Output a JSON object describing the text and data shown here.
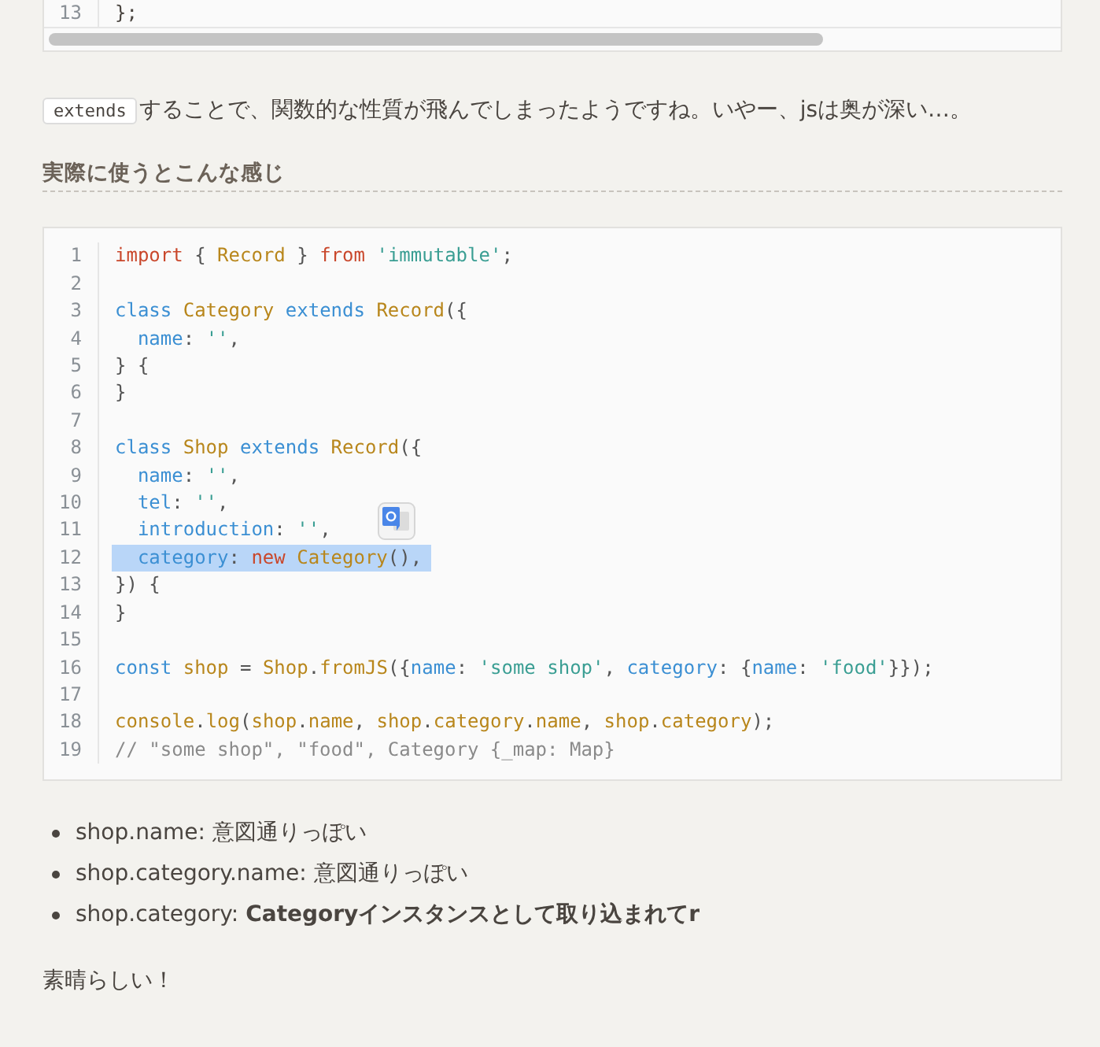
{
  "top_code": {
    "lines": [
      {
        "number": "13",
        "text": "};"
      }
    ]
  },
  "paragraph": {
    "code": "extends",
    "text": "することで、関数的な性質が飛んでしまったようですね。いやー、jsは奥が深い…。"
  },
  "heading": "実際に使うとこんな感じ",
  "code": {
    "lines": [
      {
        "number": "1",
        "selected": false,
        "tokens": [
          {
            "kind": "keyword",
            "text": "import"
          },
          {
            "kind": "plain",
            "text": " { "
          },
          {
            "kind": "name",
            "text": "Record"
          },
          {
            "kind": "plain",
            "text": " } "
          },
          {
            "kind": "keyword",
            "text": "from "
          },
          {
            "kind": "string",
            "text": "'immutable'"
          },
          {
            "kind": "plain",
            "text": ";"
          }
        ]
      },
      {
        "number": "2",
        "selected": false
      },
      {
        "number": "3",
        "selected": false,
        "tokens": [
          {
            "kind": "decl",
            "text": "class "
          },
          {
            "kind": "name",
            "text": "Category "
          },
          {
            "kind": "decl",
            "text": "extends "
          },
          {
            "kind": "name",
            "text": "Record"
          },
          {
            "kind": "plain",
            "text": "({"
          }
        ]
      },
      {
        "number": "4",
        "selected": false,
        "tokens": [
          {
            "kind": "decl",
            "text": "  name"
          },
          {
            "kind": "plain",
            "text": ": "
          },
          {
            "kind": "string",
            "text": "''"
          },
          {
            "kind": "plain",
            "text": ","
          }
        ]
      },
      {
        "number": "5",
        "selected": false,
        "tokens": [
          {
            "kind": "plain",
            "text": "} {"
          }
        ]
      },
      {
        "number": "6",
        "selected": false,
        "tokens": [
          {
            "kind": "plain",
            "text": "}"
          }
        ]
      },
      {
        "number": "7",
        "selected": false
      },
      {
        "number": "8",
        "selected": false,
        "tokens": [
          {
            "kind": "decl",
            "text": "class "
          },
          {
            "kind": "name",
            "text": "Shop "
          },
          {
            "kind": "decl",
            "text": "extends "
          },
          {
            "kind": "name",
            "text": "Record"
          },
          {
            "kind": "plain",
            "text": "({"
          }
        ]
      },
      {
        "number": "9",
        "selected": false,
        "tokens": [
          {
            "kind": "decl",
            "text": "  name"
          },
          {
            "kind": "plain",
            "text": ": "
          },
          {
            "kind": "string",
            "text": "''"
          },
          {
            "kind": "plain",
            "text": ","
          }
        ]
      },
      {
        "number": "10",
        "selected": false,
        "tokens": [
          {
            "kind": "decl",
            "text": "  tel"
          },
          {
            "kind": "plain",
            "text": ": "
          },
          {
            "kind": "string",
            "text": "''"
          },
          {
            "kind": "plain",
            "text": ","
          }
        ]
      },
      {
        "number": "11",
        "selected": false,
        "tokens": [
          {
            "kind": "decl",
            "text": "  introduction"
          },
          {
            "kind": "plain",
            "text": ": "
          },
          {
            "kind": "string",
            "text": "''"
          },
          {
            "kind": "plain",
            "text": ","
          }
        ]
      },
      {
        "number": "12",
        "selected": true,
        "tokens": [
          {
            "kind": "decl",
            "text": "  category"
          },
          {
            "kind": "plain",
            "text": ": "
          },
          {
            "kind": "keyword",
            "text": "new "
          },
          {
            "kind": "name",
            "text": "Category"
          },
          {
            "kind": "plain",
            "text": "(),"
          }
        ]
      },
      {
        "number": "13",
        "selected": false,
        "tokens": [
          {
            "kind": "plain",
            "text": "}) {"
          }
        ]
      },
      {
        "number": "14",
        "selected": false,
        "tokens": [
          {
            "kind": "plain",
            "text": "}"
          }
        ]
      },
      {
        "number": "15",
        "selected": false
      },
      {
        "number": "16",
        "selected": false,
        "tokens": [
          {
            "kind": "decl",
            "text": "const "
          },
          {
            "kind": "name",
            "text": "shop"
          },
          {
            "kind": "plain",
            "text": " = "
          },
          {
            "kind": "name",
            "text": "Shop"
          },
          {
            "kind": "plain",
            "text": "."
          },
          {
            "kind": "name",
            "text": "fromJS"
          },
          {
            "kind": "plain",
            "text": "({"
          },
          {
            "kind": "decl",
            "text": "name"
          },
          {
            "kind": "plain",
            "text": ": "
          },
          {
            "kind": "string",
            "text": "'some shop'"
          },
          {
            "kind": "plain",
            "text": ", "
          },
          {
            "kind": "decl",
            "text": "category"
          },
          {
            "kind": "plain",
            "text": ": {"
          },
          {
            "kind": "decl",
            "text": "name"
          },
          {
            "kind": "plain",
            "text": ": "
          },
          {
            "kind": "string",
            "text": "'food'"
          },
          {
            "kind": "plain",
            "text": "}});"
          }
        ]
      },
      {
        "number": "17",
        "selected": false
      },
      {
        "number": "18",
        "selected": false,
        "tokens": [
          {
            "kind": "name",
            "text": "console"
          },
          {
            "kind": "plain",
            "text": "."
          },
          {
            "kind": "name",
            "text": "log"
          },
          {
            "kind": "plain",
            "text": "("
          },
          {
            "kind": "name",
            "text": "shop"
          },
          {
            "kind": "plain",
            "text": "."
          },
          {
            "kind": "name",
            "text": "name"
          },
          {
            "kind": "plain",
            "text": ", "
          },
          {
            "kind": "name",
            "text": "shop"
          },
          {
            "kind": "plain",
            "text": "."
          },
          {
            "kind": "name",
            "text": "category"
          },
          {
            "kind": "plain",
            "text": "."
          },
          {
            "kind": "name",
            "text": "name"
          },
          {
            "kind": "plain",
            "text": ", "
          },
          {
            "kind": "name",
            "text": "shop"
          },
          {
            "kind": "plain",
            "text": "."
          },
          {
            "kind": "name",
            "text": "category"
          },
          {
            "kind": "plain",
            "text": ");"
          }
        ]
      },
      {
        "number": "19",
        "selected": false,
        "tokens": [
          {
            "kind": "comment",
            "text": "// \"some shop\", \"food\", Category {_map: Map}"
          }
        ]
      }
    ]
  },
  "bullets": [
    "shop.name: 意図通りっぽい",
    "shop.category.name: 意図通りっぽい",
    "shop.category: **Categoryインスタンスとして取り込まれてr**"
  ],
  "closing": "素晴らしい！"
}
